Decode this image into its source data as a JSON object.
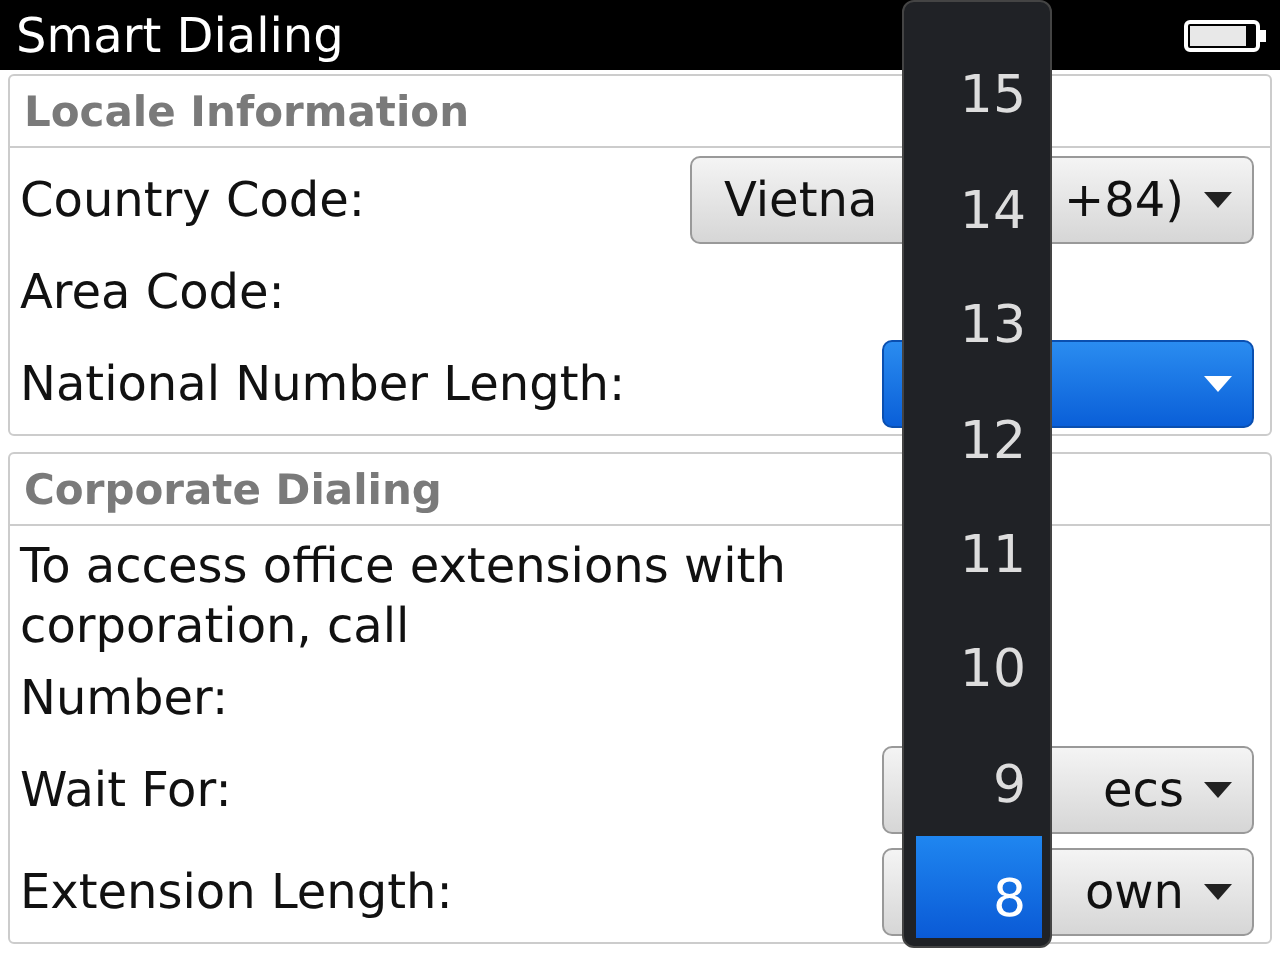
{
  "window": {
    "title": "Smart Dialing"
  },
  "sections": [
    {
      "title": "Locale Information",
      "rows": [
        {
          "kind": "dropdown",
          "label": "Country Code:",
          "value_start": "Vietna",
          "value_end": "+84)",
          "focused": false
        },
        {
          "kind": "label",
          "label": "Area Code:"
        },
        {
          "kind": "dropdown",
          "label": "National Number Length:",
          "focused": true
        }
      ]
    },
    {
      "title": "Corporate Dialing",
      "rows": [
        {
          "kind": "text",
          "label": "To access office extensions with\ncorporation, call"
        },
        {
          "kind": "label",
          "label": "Number:"
        },
        {
          "kind": "dropdown",
          "label": "Wait For:",
          "value_end": "ecs",
          "focused": false
        },
        {
          "kind": "dropdown",
          "label": "Extension Length:",
          "value_end": "own",
          "focused": false
        }
      ]
    }
  ],
  "picker": {
    "items": [
      {
        "label": "15",
        "selected": false
      },
      {
        "label": "14",
        "selected": false
      },
      {
        "label": "13",
        "selected": false
      },
      {
        "label": "12",
        "selected": false
      },
      {
        "label": "11",
        "selected": false
      },
      {
        "label": "10",
        "selected": false
      },
      {
        "label": "9",
        "selected": false
      },
      {
        "label": "8",
        "selected": true
      }
    ]
  }
}
